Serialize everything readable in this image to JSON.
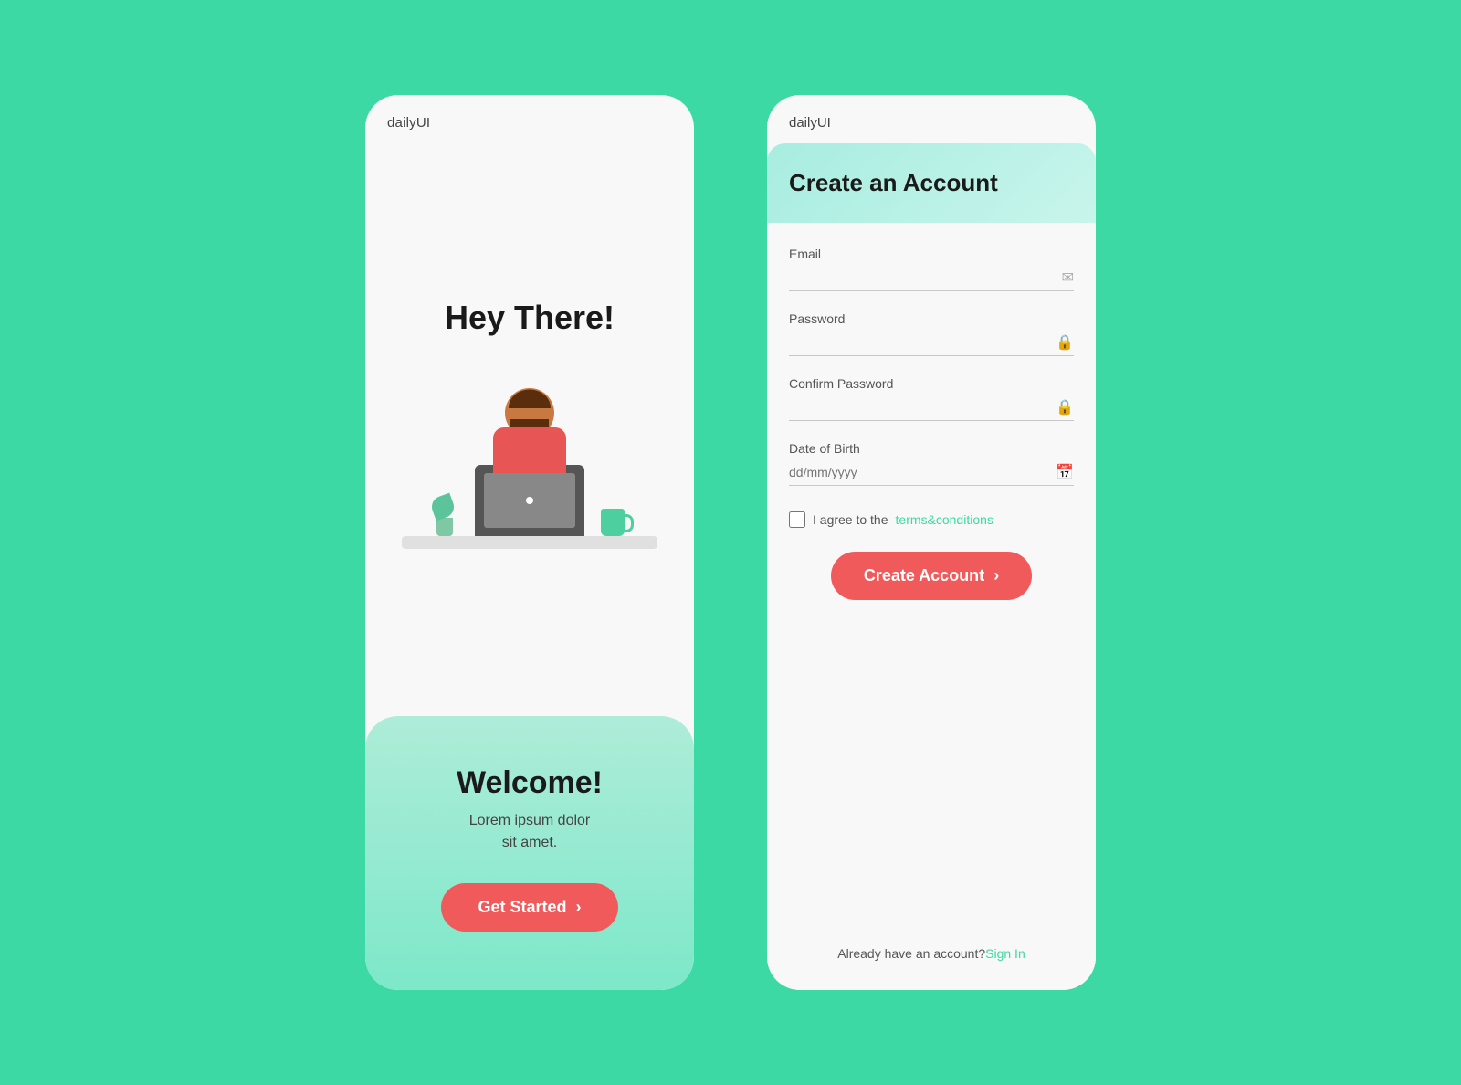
{
  "left_card": {
    "logo": "dailyUI",
    "hey_there": "Hey There!",
    "welcome_title": "Welcome!",
    "welcome_sub": "Lorem ipsum dolor\nsit amet.",
    "get_started_label": "Get Started"
  },
  "right_card": {
    "logo": "dailyUI",
    "title": "Create an Account",
    "email_label": "Email",
    "email_placeholder": "",
    "password_label": "Password",
    "password_placeholder": "",
    "confirm_password_label": "Confirm Password",
    "confirm_password_placeholder": "",
    "dob_label": "Date of Birth",
    "dob_placeholder": "dd/mm/yyyy",
    "terms_text": "I agree to the ",
    "terms_link_text": "terms&conditions",
    "create_account_label": "Create Account",
    "signin_text": "Already have an account?",
    "signin_link": "Sign In"
  },
  "colors": {
    "background": "#3dd9a4",
    "card_bg": "#f7f8f7",
    "btn_red": "#f05a5a",
    "teal_accent": "#3dd9a4",
    "header_gradient_start": "#a8ede0",
    "header_gradient_end": "#c8f5ec"
  }
}
